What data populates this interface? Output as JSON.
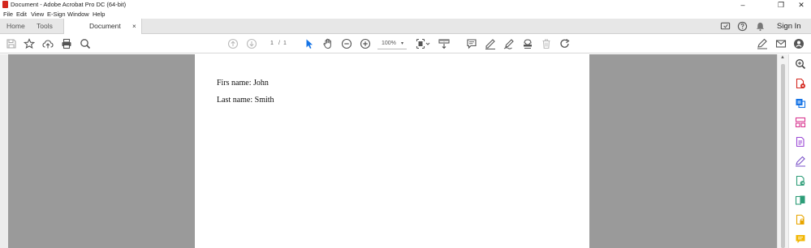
{
  "window": {
    "title": "Document - Adobe Acrobat Pro DC (64-bit)",
    "controls": {
      "minimize": "–",
      "restore": "❐",
      "close": "✕"
    }
  },
  "menu": {
    "items": [
      "File",
      "Edit",
      "View",
      "E-Sign",
      "Window",
      "Help"
    ]
  },
  "tabs": {
    "home": "Home",
    "tools": "Tools",
    "document": "Document",
    "close": "×"
  },
  "header": {
    "sign_in": "Sign In",
    "icons": [
      "share-screen-icon",
      "help-icon",
      "notification-bell-icon"
    ]
  },
  "toolbar": {
    "icons": [
      "save-icon",
      "bookmark-star-icon",
      "upload-cloud-icon",
      "print-icon",
      "find-zoom-icon",
      "previous-page-icon",
      "next-page-icon",
      "select-arrow-icon",
      "hand-tool-icon",
      "zoom-out-icon",
      "zoom-in-icon",
      "page-fit-icon",
      "marquee-ruler-icon",
      "comment-icon",
      "highlight-pen-icon",
      "draw-pencil-icon",
      "stamp-icon",
      "delete-icon",
      "redo-icon",
      "sign-pen-icon",
      "email-icon",
      "user-share-icon"
    ],
    "page_current": "1",
    "page_separator": "/",
    "page_total": "1",
    "zoom_value": "100%",
    "zoom_arrow": "▾"
  },
  "document": {
    "lines": [
      "Firs name: John",
      "Last name: Smith"
    ]
  },
  "right_pane": {
    "icons": [
      "search-zoom-icon",
      "export-pdf-icon",
      "create-pdf-icon",
      "organize-pages-icon",
      "edit-pdf-icon",
      "fill-sign-icon",
      "export-file-icon",
      "combine-files-icon",
      "protect-icon",
      "comment-pane-icon"
    ]
  },
  "colors": {
    "accent_blue": "#1473e6",
    "pdf_red": "#d4271e",
    "work_area_gray": "#9a9a9a"
  }
}
